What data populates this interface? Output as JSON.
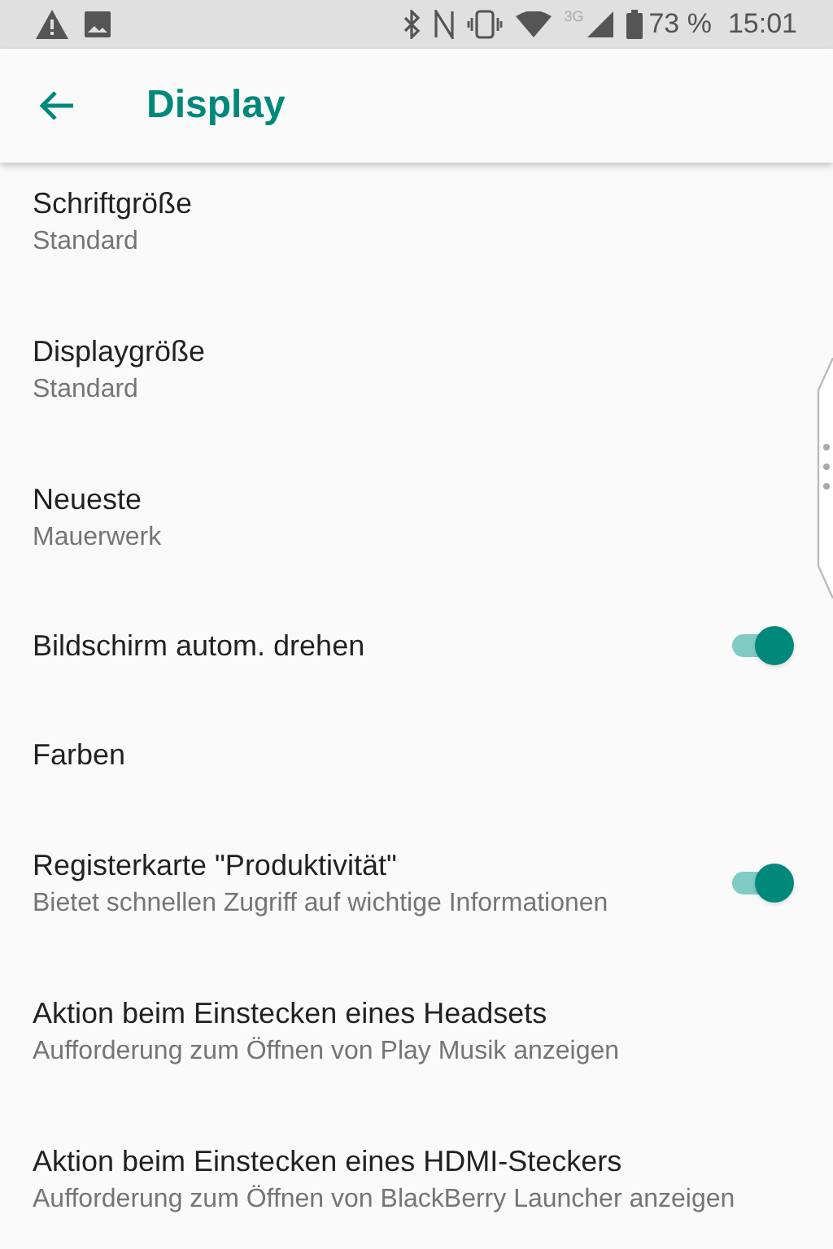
{
  "status_bar": {
    "network": "3G",
    "battery": "73 %",
    "time": "15:01"
  },
  "toolbar": {
    "title": "Display"
  },
  "settings": [
    {
      "kind": "text",
      "title": "Schriftgröße",
      "summary": "Standard"
    },
    {
      "kind": "text",
      "title": "Displaygröße",
      "summary": "Standard"
    },
    {
      "kind": "text",
      "title": "Neueste",
      "summary": "Mauerwerk"
    },
    {
      "kind": "switch",
      "title": "Bildschirm autom. drehen",
      "on": true
    },
    {
      "kind": "text",
      "title": "Farben"
    },
    {
      "kind": "switch",
      "title": "Registerkarte \"Produktivität\"",
      "summary": "Bietet schnellen Zugriff auf wichtige Informationen",
      "on": true
    },
    {
      "kind": "text",
      "title": "Aktion beim Einstecken eines Headsets",
      "summary": "Aufforderung zum Öffnen von Play Musik anzeigen"
    },
    {
      "kind": "text",
      "title": "Aktion beim Einstecken eines HDMI-Steckers",
      "summary": "Aufforderung zum Öffnen von BlackBerry Launcher anzeigen"
    }
  ]
}
